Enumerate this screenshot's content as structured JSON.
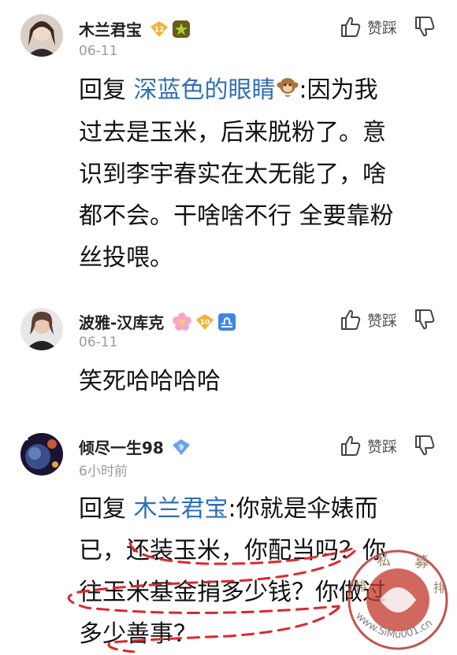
{
  "comments": [
    {
      "username": "木兰君宝",
      "date": "06-11",
      "level": "12",
      "like_label": "赞踩",
      "reply_prefix": "回复",
      "mention": "深蓝色的眼睛",
      "mention_emoji": "monkey-emoji",
      "lines": [
        ":因为我",
        "过去是玉米，后来脱粉了。意",
        "识到李宇春实在太无能了，啥",
        "都不会。干啥啥不行 全要靠粉",
        "丝投喂。"
      ]
    },
    {
      "username": "波雅-汉库克",
      "date": "06-11",
      "level": "10",
      "like_label": "赞踩",
      "lines": [
        "笑死哈哈哈哈"
      ]
    },
    {
      "username": "倾尽一生98",
      "date": "6小时前",
      "level": "9",
      "like_label": "赞踩",
      "reply_prefix": "回复",
      "mention": "木兰君宝",
      "lines": [
        ":你就是伞婊而",
        "已，还装玉米，你配当吗？你",
        "往玉米基金捐多少钱？你做过",
        "多少善事？"
      ]
    }
  ],
  "watermark": {
    "text": "www.SiMu001.cn",
    "chars": [
      "私",
      "募",
      "排",
      "排"
    ]
  },
  "colors": {
    "mention": "#2f6fb5",
    "annotation": "#e0262b",
    "badge_gold": "#f2b233",
    "badge_blue": "#6aa3ee"
  }
}
